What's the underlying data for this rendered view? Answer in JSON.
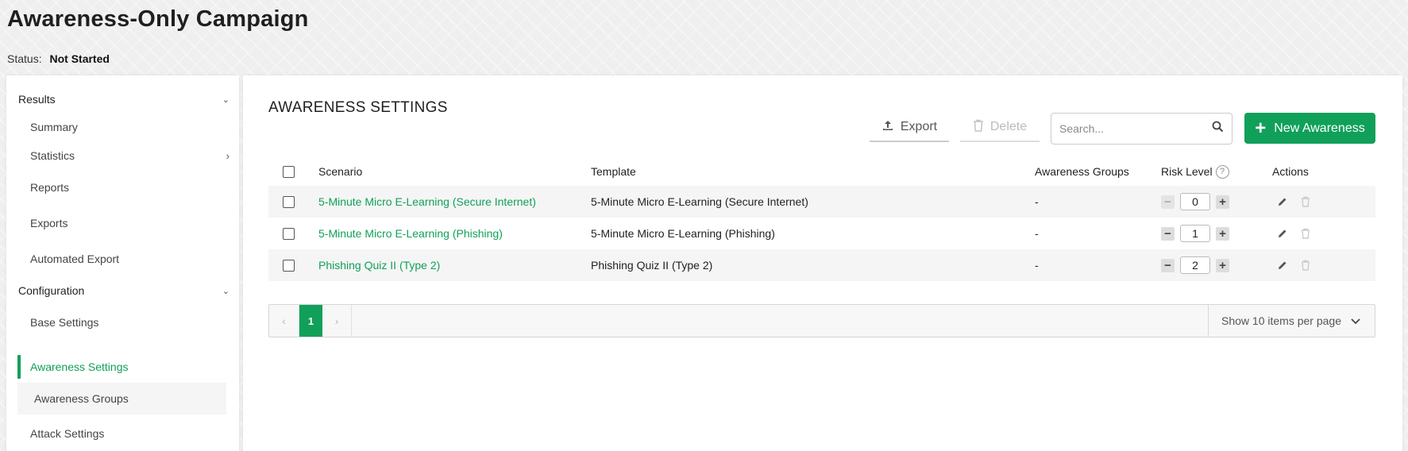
{
  "header": {
    "title": "Awareness-Only Campaign",
    "status_label": "Status:",
    "status_value": "Not Started"
  },
  "sidebar": {
    "results": {
      "label": "Results",
      "items": [
        "Summary",
        "Statistics",
        "Reports",
        "Exports",
        "Automated Export"
      ]
    },
    "configuration": {
      "label": "Configuration",
      "items": [
        "Base Settings",
        "Awareness Settings",
        "Awareness Groups",
        "Attack Settings"
      ]
    },
    "active_item": "Awareness Settings"
  },
  "main": {
    "title": "AWARENESS SETTINGS",
    "toolbar": {
      "export_label": "Export",
      "delete_label": "Delete",
      "search_placeholder": "Search...",
      "new_label": "New Awareness"
    },
    "table": {
      "columns": [
        "Scenario",
        "Template",
        "Awareness Groups",
        "Risk Level",
        "Actions"
      ],
      "rows": [
        {
          "scenario": "5-Minute Micro E-Learning (Secure Internet)",
          "template": "5-Minute Micro E-Learning (Secure Internet)",
          "groups": "-",
          "risk": "0"
        },
        {
          "scenario": "5-Minute Micro E-Learning (Phishing)",
          "template": "5-Minute Micro E-Learning (Phishing)",
          "groups": "-",
          "risk": "1"
        },
        {
          "scenario": "Phishing Quiz II (Type 2)",
          "template": "Phishing Quiz II (Type 2)",
          "groups": "-",
          "risk": "2"
        }
      ]
    },
    "pagination": {
      "prev": "‹",
      "current_page": "1",
      "next": "›",
      "per_page_label": "Show 10 items per page"
    }
  },
  "colors": {
    "accent": "#10a05a",
    "background": "#efefef"
  }
}
